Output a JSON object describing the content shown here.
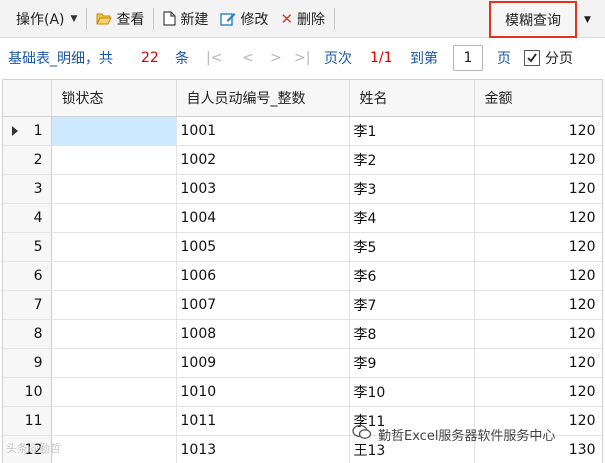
{
  "toolbar": {
    "operate_label": "操作(A)",
    "view_label": "查看",
    "new_label": "新建",
    "edit_label": "修改",
    "delete_label": "删除",
    "fuzzy_query_label": "模糊查询"
  },
  "pager": {
    "table_name": "基础表_明细",
    "total_prefix": "，共",
    "total_count": "22",
    "total_suffix": "条",
    "first": "|<",
    "prev": "<",
    "next": ">",
    "last": ">|",
    "page_count_label": "页次",
    "page_count_value": "1/1",
    "goto_label": "到第",
    "goto_value": "1",
    "page_unit": "页",
    "paging_label": "分页",
    "paging_checked": true
  },
  "grid": {
    "columns": [
      "锁状态",
      "自人员动编号_整数",
      "姓名",
      "金额"
    ],
    "rows": [
      {
        "rn": "1",
        "lock": "",
        "id": "1001",
        "name": "李1",
        "amount": "120"
      },
      {
        "rn": "2",
        "lock": "",
        "id": "1002",
        "name": "李2",
        "amount": "120"
      },
      {
        "rn": "3",
        "lock": "",
        "id": "1003",
        "name": "李3",
        "amount": "120"
      },
      {
        "rn": "4",
        "lock": "",
        "id": "1004",
        "name": "李4",
        "amount": "120"
      },
      {
        "rn": "5",
        "lock": "",
        "id": "1005",
        "name": "李5",
        "amount": "120"
      },
      {
        "rn": "6",
        "lock": "",
        "id": "1006",
        "name": "李6",
        "amount": "120"
      },
      {
        "rn": "7",
        "lock": "",
        "id": "1007",
        "name": "李7",
        "amount": "120"
      },
      {
        "rn": "8",
        "lock": "",
        "id": "1008",
        "name": "李8",
        "amount": "120"
      },
      {
        "rn": "9",
        "lock": "",
        "id": "1009",
        "name": "李9",
        "amount": "120"
      },
      {
        "rn": "10",
        "lock": "",
        "id": "1010",
        "name": "李10",
        "amount": "120"
      },
      {
        "rn": "11",
        "lock": "",
        "id": "1011",
        "name": "李11",
        "amount": "120"
      },
      {
        "rn": "12",
        "lock": "",
        "id": "1013",
        "name": "王13",
        "amount": "130"
      }
    ]
  },
  "watermark": {
    "left_text": "头条@勤哲",
    "right_text": "勤哲Excel服务器软件服务中心"
  },
  "colors": {
    "link_blue": "#1a56a8",
    "count_red": "#e00000",
    "highlight_border": "#e2341d",
    "selected_row": "#cde8ff"
  }
}
